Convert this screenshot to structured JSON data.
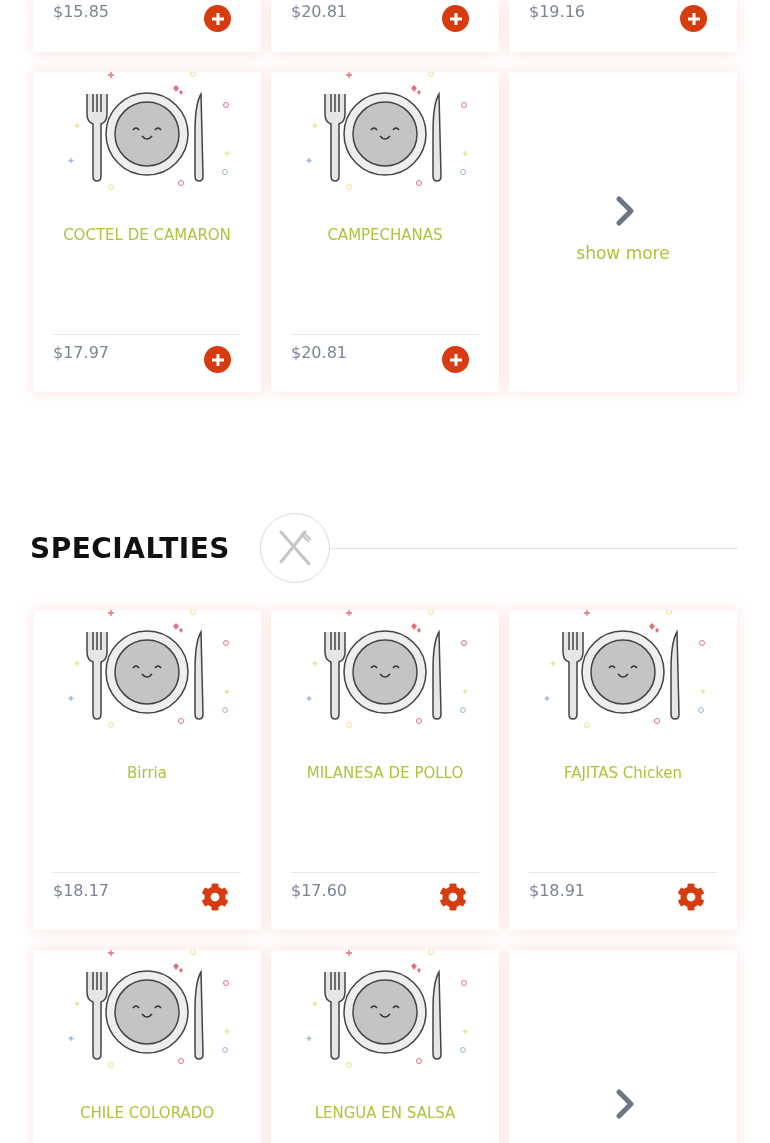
{
  "sections": [
    {
      "rows": [
        {
          "items": [
            {
              "kind": "dish",
              "price": "$15.85",
              "button": {
                "kind": "add"
              }
            },
            {
              "kind": "dish",
              "price": "$20.81",
              "button": {
                "kind": "add"
              }
            },
            {
              "kind": "dish",
              "price": "$19.16",
              "button": {
                "kind": "add"
              }
            }
          ]
        },
        {
          "items": [
            {
              "kind": "dish",
              "name": "COCTEL DE CAMARON",
              "price": "$17.97",
              "button": {
                "kind": "add"
              }
            },
            {
              "kind": "dish",
              "name": "CAMPECHANAS",
              "price": "$20.81",
              "button": {
                "kind": "add"
              }
            },
            {
              "kind": "more",
              "label": "show more"
            }
          ]
        }
      ]
    },
    {
      "title": "SPECIALTIES",
      "rows": [
        {
          "items": [
            {
              "kind": "dish",
              "name": "Birria",
              "price": "$18.17",
              "button": {
                "kind": "customize"
              }
            },
            {
              "kind": "dish",
              "name": "MILANESA DE POLLO",
              "price": "$17.60",
              "button": {
                "kind": "customize"
              }
            },
            {
              "kind": "dish",
              "name": "FAJITAS Chicken",
              "price": "$18.91",
              "button": {
                "kind": "customize"
              }
            }
          ]
        },
        {
          "items": [
            {
              "kind": "dish",
              "name": "CHILE COLORADO"
            },
            {
              "kind": "dish",
              "name": "LENGUA EN SALSA"
            },
            {
              "kind": "more"
            }
          ]
        }
      ]
    }
  ]
}
